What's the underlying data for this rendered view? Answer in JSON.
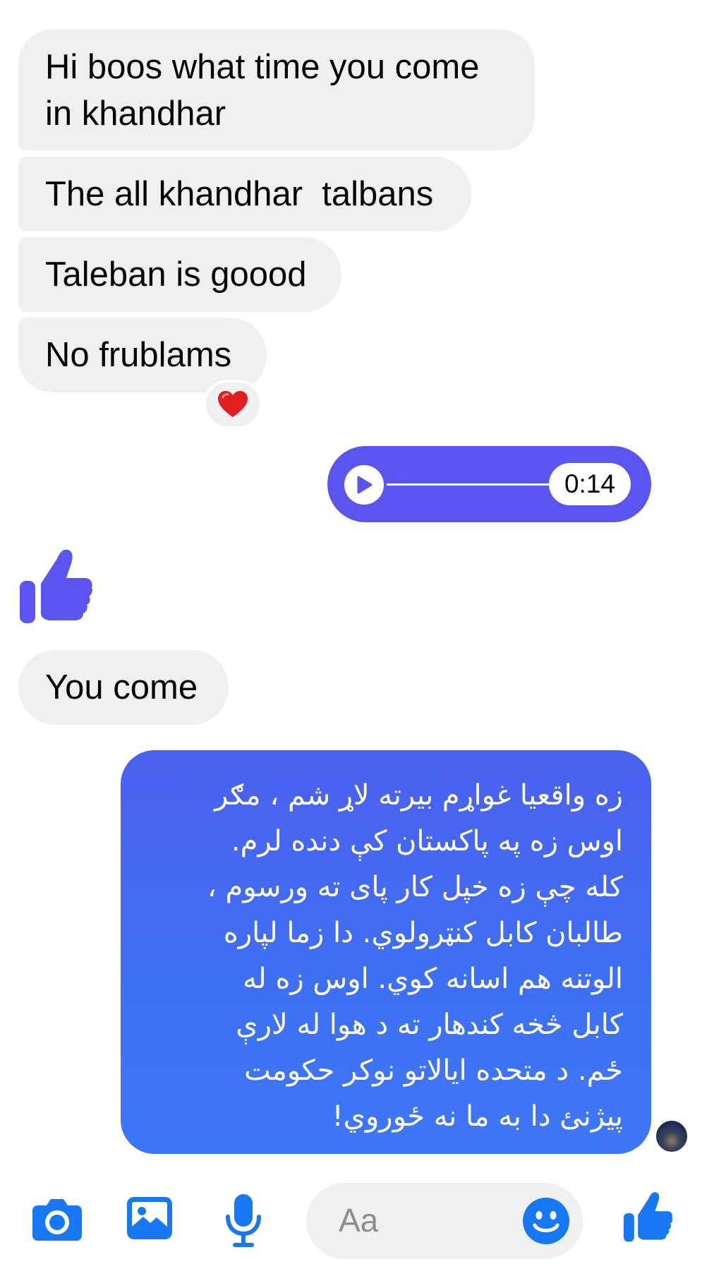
{
  "messages": {
    "m1": "Hi boos what time you come in khandhar",
    "m2": "The all khandhar  talbans",
    "m3": "Taleban is goood",
    "m4": "No frublams",
    "m4_reaction": "❤️",
    "audio_duration": "0:14",
    "m5": "You come",
    "sent_text": "زه واقعیا غواړم بیرته لاړ شم ، مګر\nاوس زه په پاکستان کې دنده لرم.\nکله چې زه خپل کار پای ته ورسوم ،\nطالبان کابل کنټرولوي. دا زما لپاره\nالوتنه هم اسانه کوي. اوس زه له\nکابل څخه کندهار ته د هوا له لارې\nځم. د متحده ایالاتو نوکر حکومت\nپیژنئ دا به ما نه ځوروي!"
  },
  "composer": {
    "placeholder": "Aa",
    "icons": [
      "camera-icon",
      "image-icon",
      "microphone-icon",
      "emoji-icon",
      "thumbs-up-icon"
    ]
  },
  "colors": {
    "accent": "#5b55f0",
    "sent_bubble": "#4169f2",
    "icon_blue": "#1877f2",
    "incoming_bubble": "#f0f0f0"
  }
}
